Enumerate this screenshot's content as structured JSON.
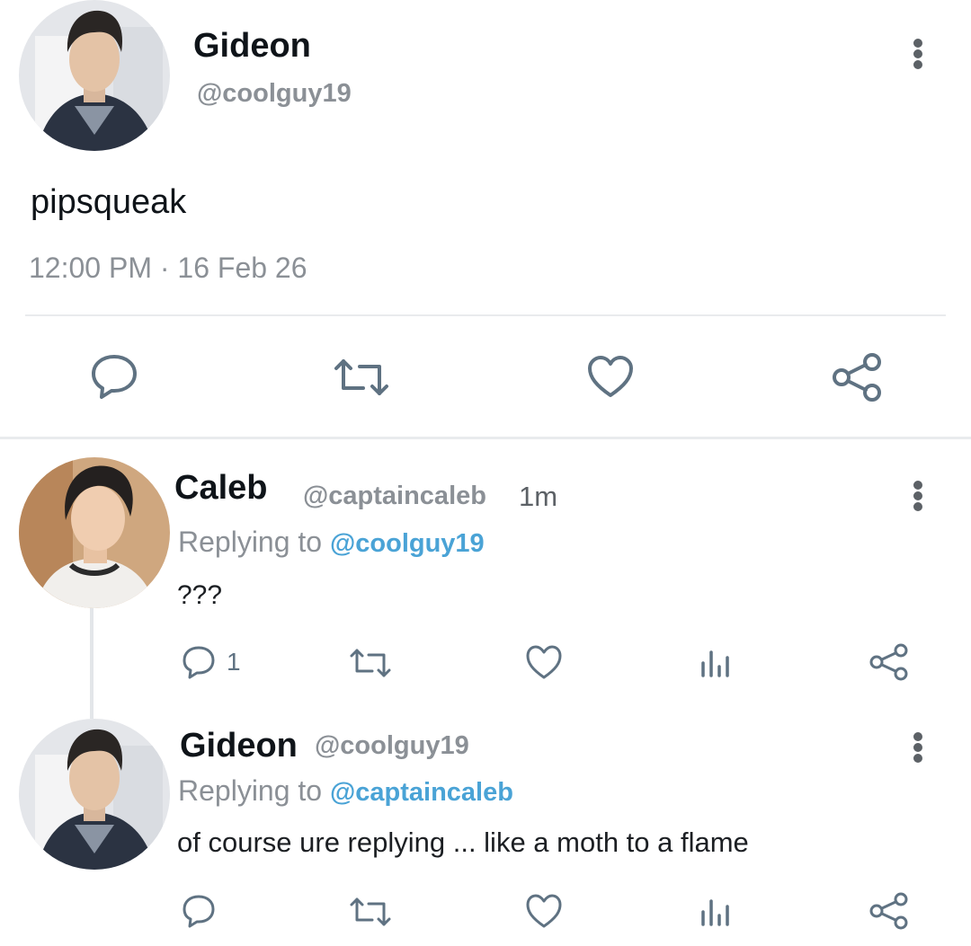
{
  "main_tweet": {
    "author": {
      "name": "Gideon",
      "handle": "@coolguy19",
      "avatar": "profile-photo"
    },
    "text": "pipsqueak",
    "timestamp": "12:00 PM · 16 Feb 26",
    "actions": [
      "reply-icon",
      "retweet-icon",
      "like-icon",
      "share-icon"
    ]
  },
  "replies": [
    {
      "author": {
        "name": "Caleb",
        "handle": "@captaincaleb",
        "avatar": "profile-photo"
      },
      "time": "1m",
      "replying_prefix": "Replying to",
      "replying_to": "@coolguy19",
      "text": "???",
      "reply_count": "1",
      "actions": [
        "reply-icon",
        "retweet-icon",
        "like-icon",
        "views-icon",
        "share-icon"
      ]
    },
    {
      "author": {
        "name": "Gideon",
        "handle": "@coolguy19",
        "avatar": "profile-photo"
      },
      "replying_prefix": "Replying to",
      "replying_to": "@captaincaleb",
      "text": "of course ure replying ... like a moth to a flame",
      "actions": [
        "reply-icon",
        "retweet-icon",
        "like-icon",
        "views-icon",
        "share-icon"
      ]
    }
  ],
  "colors": {
    "icon": "#5f7282",
    "link": "#4aa3d6",
    "muted": "#8b9096",
    "divider": "#e9ebed"
  }
}
